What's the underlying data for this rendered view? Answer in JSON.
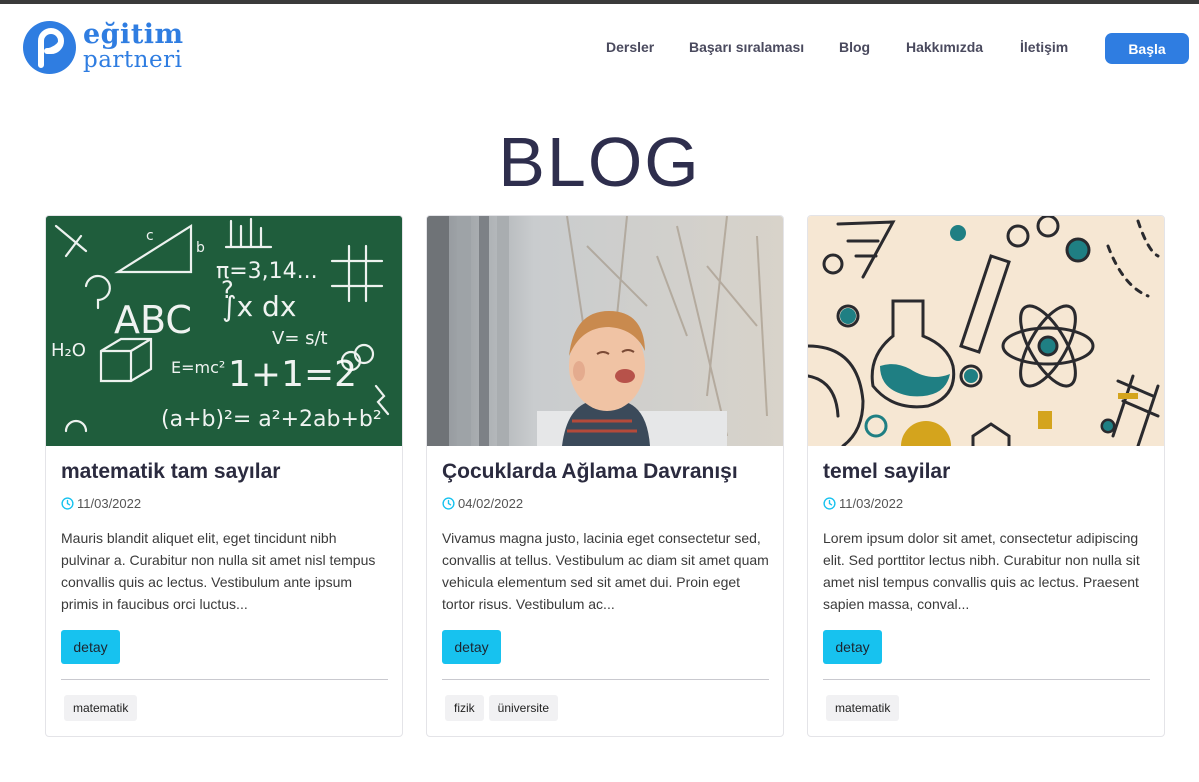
{
  "brand": {
    "line1": "eğitim",
    "line2": "partneri",
    "color": "#2f7de1"
  },
  "nav": {
    "items": [
      {
        "label": "Dersler"
      },
      {
        "label": "Başarı sıralaması"
      },
      {
        "label": "Blog"
      },
      {
        "label": "Hakkımızda"
      },
      {
        "label": "İletişim"
      }
    ],
    "cta_label": "Başla"
  },
  "page": {
    "title": "BLOG"
  },
  "posts": [
    {
      "title": "matematik tam sayılar",
      "date": "11/03/2022",
      "excerpt": "Mauris blandit aliquet elit, eget tincidunt nibh pulvinar a. Curabitur non nulla sit amet nisl tempus convallis quis ac lectus. Vestibulum ante ipsum primis in faucibus orci luctus...",
      "button": "detay",
      "tags": [
        "matematik"
      ],
      "image": "chalkboard-math-image"
    },
    {
      "title": "Çocuklarda Ağlama Davranışı",
      "date": "04/02/2022",
      "excerpt": "Vivamus magna justo, lacinia eget consectetur sed, convallis at tellus. Vestibulum ac diam sit amet quam vehicula elementum sed sit amet dui. Proin eget tortor risus. Vestibulum ac...",
      "button": "detay",
      "tags": [
        "fizik",
        "üniversite"
      ],
      "image": "crying-child-photo"
    },
    {
      "title": "temel sayilar",
      "date": "11/03/2022",
      "excerpt": "Lorem ipsum dolor sit amet, consectetur adipiscing elit. Sed porttitor lectus nibh. Curabitur non nulla sit amet nisl tempus convallis quis ac lectus. Praesent sapien massa, conval...",
      "button": "detay",
      "tags": [
        "matematik"
      ],
      "image": "science-illustration-image"
    }
  ],
  "colors": {
    "accent": "#2f7de1",
    "detay_button": "#17c2ef",
    "clock_icon": "#17c2ef",
    "title": "#2e2e4d"
  }
}
